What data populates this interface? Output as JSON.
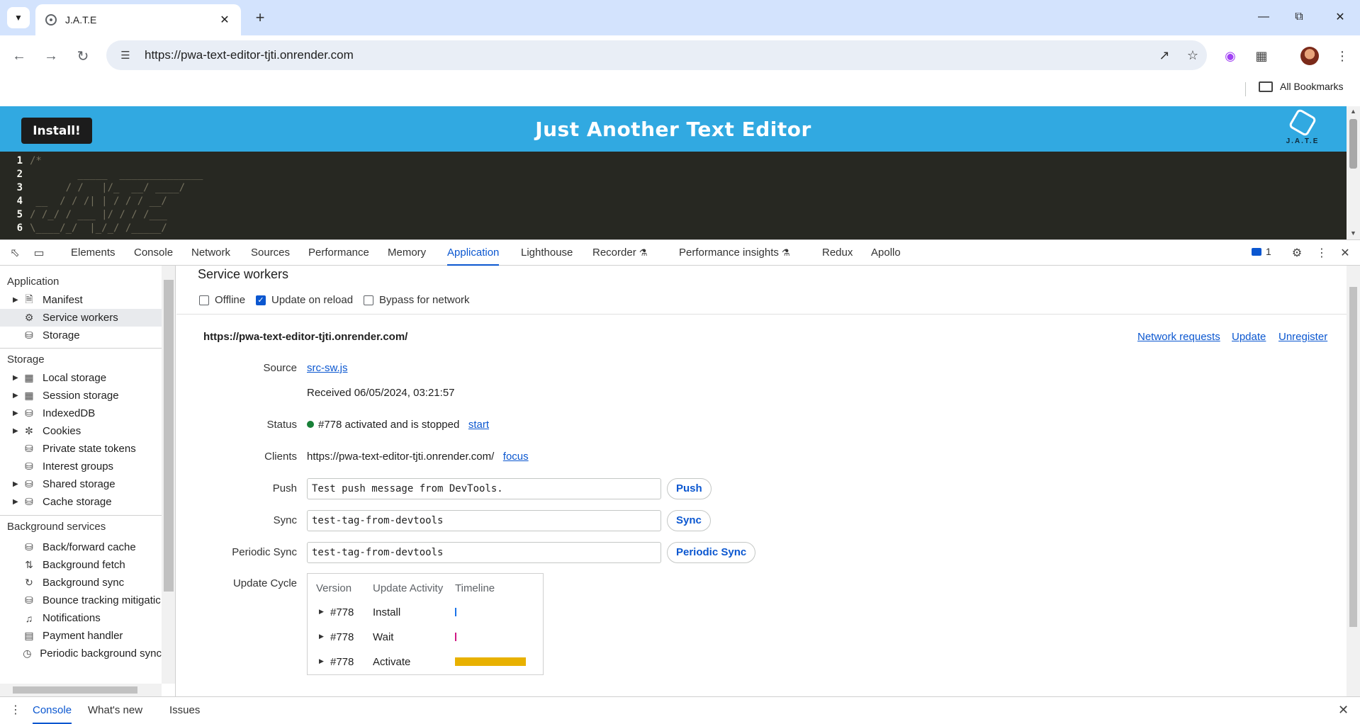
{
  "browser": {
    "tab_title": "J.A.T.E",
    "url": "https://pwa-text-editor-tjti.onrender.com",
    "all_bookmarks": "All Bookmarks"
  },
  "app": {
    "install_label": "Install!",
    "title": "Just Another Text Editor",
    "logo_text": "J.A.T.E",
    "header_color": "#31a9e1",
    "editor_lines": [
      {
        "n": "1",
        "code": "/*"
      },
      {
        "n": "2",
        "code": "        _____  ______________"
      },
      {
        "n": "3",
        "code": "      / /   |/_  __/ ____/"
      },
      {
        "n": "4",
        "code": " __  / / /| | / / / __/"
      },
      {
        "n": "5",
        "code": "/ /_/ / ___ |/ / / /___"
      },
      {
        "n": "6",
        "code": "\\____/_/  |_/_/ /_____/"
      }
    ]
  },
  "devtools": {
    "tabs": [
      "Elements",
      "Console",
      "Network",
      "Sources",
      "Performance",
      "Memory",
      "Application",
      "Lighthouse",
      "Recorder",
      "Performance insights",
      "Redux",
      "Apollo"
    ],
    "active_tab": "Application",
    "issues_count": "1",
    "sidebar": {
      "application_heading": "Application",
      "application_items": [
        "Manifest",
        "Service workers",
        "Storage"
      ],
      "storage_heading": "Storage",
      "storage_items": [
        "Local storage",
        "Session storage",
        "IndexedDB",
        "Cookies",
        "Private state tokens",
        "Interest groups",
        "Shared storage",
        "Cache storage"
      ],
      "background_heading": "Background services",
      "background_items": [
        "Back/forward cache",
        "Background fetch",
        "Background sync",
        "Bounce tracking mitigatic",
        "Notifications",
        "Payment handler",
        "Periodic background sync"
      ]
    },
    "service_workers": {
      "title": "Service workers",
      "offline_label": "Offline",
      "offline_checked": false,
      "update_on_reload_label": "Update on reload",
      "update_on_reload_checked": true,
      "bypass_label": "Bypass for network",
      "bypass_checked": false,
      "scope": "https://pwa-text-editor-tjti.onrender.com/",
      "network_requests": "Network requests",
      "update": "Update",
      "unregister": "Unregister",
      "source_label": "Source",
      "source_file": "src-sw.js",
      "received": "Received 06/05/2024, 03:21:57",
      "status_label": "Status",
      "status_text": "#778 activated and is stopped",
      "status_action": "start",
      "clients_label": "Clients",
      "clients_url": "https://pwa-text-editor-tjti.onrender.com/",
      "clients_action": "focus",
      "push_label": "Push",
      "push_value": "Test push message from DevTools.",
      "push_button": "Push",
      "sync_label": "Sync",
      "sync_value": "test-tag-from-devtools",
      "sync_button": "Sync",
      "periodic_label": "Periodic Sync",
      "periodic_value": "test-tag-from-devtools",
      "periodic_button": "Periodic Sync",
      "cycle_label": "Update Cycle",
      "cycle_headers": [
        "Version",
        "Update Activity",
        "Timeline"
      ],
      "cycle_rows": [
        {
          "version": "#778",
          "activity": "Install",
          "color": "#1a73e8"
        },
        {
          "version": "#778",
          "activity": "Wait",
          "color": "#d01884"
        },
        {
          "version": "#778",
          "activity": "Activate",
          "color": "#e8b100"
        }
      ]
    },
    "drawer_tabs": [
      "Console",
      "What's new",
      "Issues"
    ],
    "drawer_active": "Console"
  }
}
